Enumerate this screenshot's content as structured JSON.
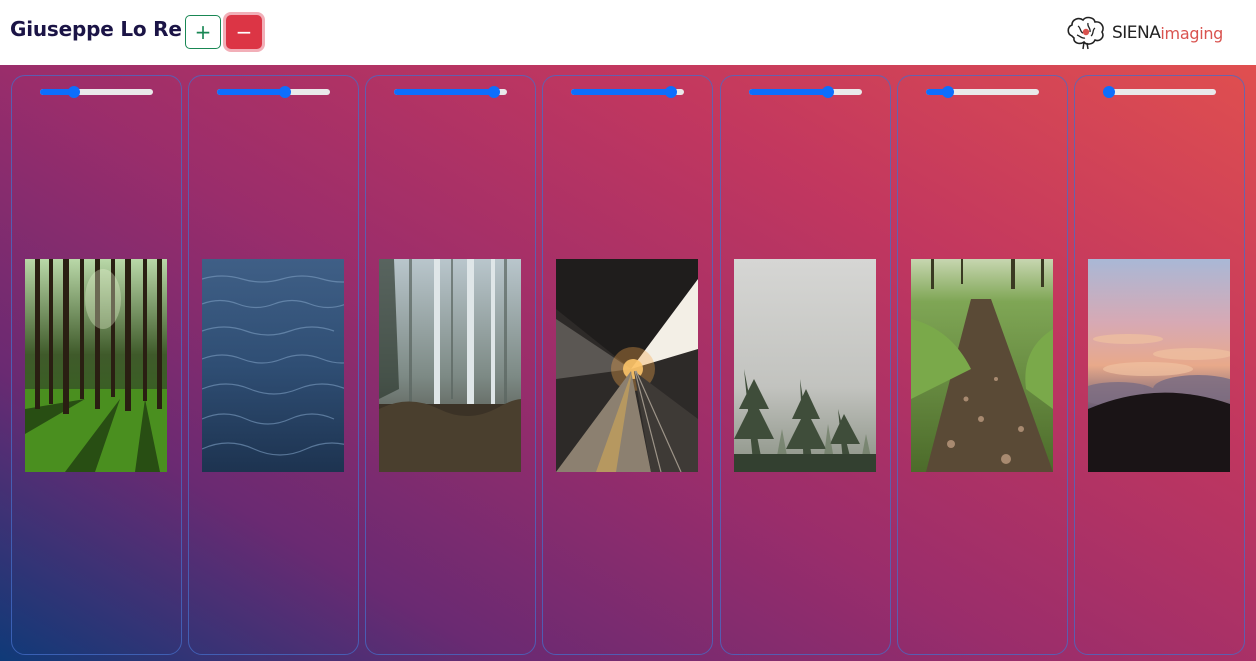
{
  "header": {
    "title": "Giuseppe Lo Re",
    "add_label": "+",
    "remove_label": "−",
    "brand": {
      "name": "SIENA",
      "suffix": "imaging",
      "logo_icon": "brain-icon"
    }
  },
  "colors": {
    "primary": "#0d6efd",
    "success": "#198754",
    "danger": "#dc3545",
    "brand_accent": "#d9534f"
  },
  "columns": [
    {
      "slider_value": 28,
      "image": "forest-sunlight"
    },
    {
      "slider_value": 61,
      "image": "ocean-water"
    },
    {
      "slider_value": 93,
      "image": "misty-birch-forest"
    },
    {
      "slider_value": 93,
      "image": "train-station-sunset"
    },
    {
      "slider_value": 72,
      "image": "foggy-pine-trees"
    },
    {
      "slider_value": 16,
      "image": "forest-path"
    },
    {
      "slider_value": 0,
      "image": "sky-above-clouds"
    }
  ]
}
